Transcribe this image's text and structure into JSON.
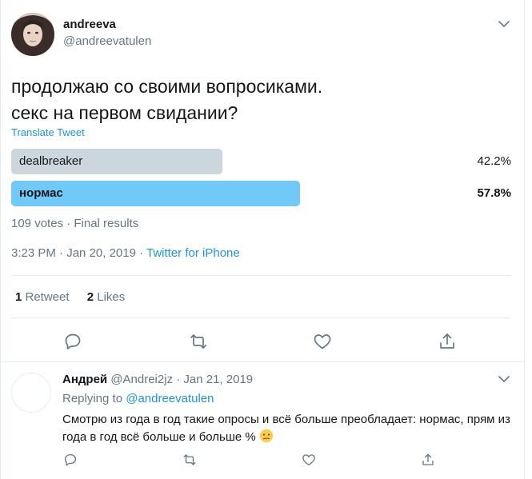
{
  "tweet": {
    "display_name": "andreeva",
    "handle": "@andreevatulen",
    "text_line1": "продолжаю со своими вопросиками.",
    "text_line2": "секс на первом свидании?",
    "translate_label": "Translate Tweet",
    "poll": {
      "options": [
        {
          "label": "dealbreaker",
          "percent_label": "42.2%",
          "percent": 42.2,
          "winner": false,
          "color": "#ccd6dd"
        },
        {
          "label": "нормас",
          "percent_label": "57.8%",
          "percent": 57.8,
          "winner": true,
          "color": "#71c9f8"
        }
      ],
      "meta": "109 votes · Final results"
    },
    "time": "3:23 PM · Jan 20, 2019 · ",
    "source": "Twitter for iPhone",
    "stats": {
      "retweets_count": "1",
      "retweets_label": " Retweet",
      "likes_count": "2",
      "likes_label": " Likes"
    },
    "icons": [
      "reply-icon",
      "retweet-icon",
      "like-icon",
      "share-icon",
      "chevron-down-icon"
    ]
  },
  "reply": {
    "name": "Андрей",
    "handle_date": " @Andrei2jz · Jan 21, 2019",
    "replying_prefix": "Replying to ",
    "replying_mention": "@andreevatulen",
    "text": "Смотрю из года в год такие опросы и всё больше преобладает: нормас, прям из года в год всё больше и больше % ",
    "emoji": "confused-face-emoji"
  },
  "colors": {
    "accent": "#1b95e0",
    "secondary_text": "#657786",
    "primary_text": "#14171a",
    "divider": "#e6ecf0"
  }
}
